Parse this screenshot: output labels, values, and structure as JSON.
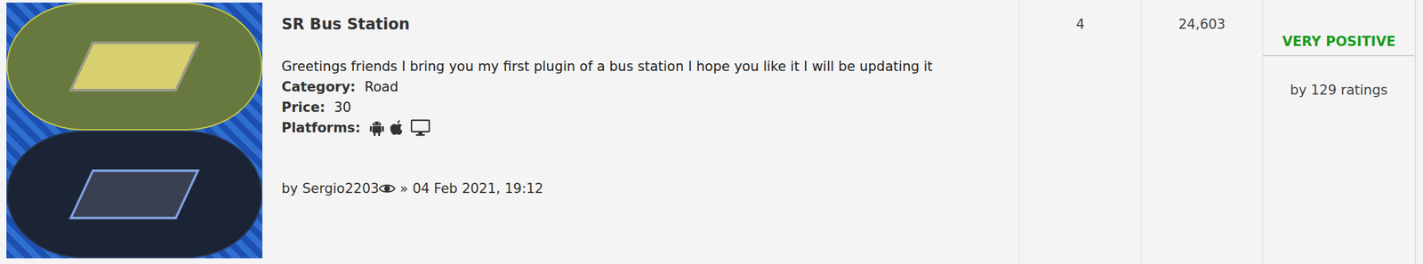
{
  "plugin": {
    "title": "SR Bus Station",
    "description": "Greetings friends I bring you my first plugin of a bus station I hope you like it I will be updating it",
    "fields": [
      {
        "label": "Category:",
        "value": "Road"
      },
      {
        "label": "Price:",
        "value": "30"
      }
    ],
    "platforms_label": "Platforms:",
    "by": "by",
    "author": "Sergio2203",
    "separator": "»",
    "date": "04 Feb 2021, 19:12"
  },
  "replies": "4",
  "views": "24,603",
  "rating": {
    "label": "VERY POSITIVE",
    "count": "by 129 ratings",
    "color": "#1a9a1a"
  }
}
